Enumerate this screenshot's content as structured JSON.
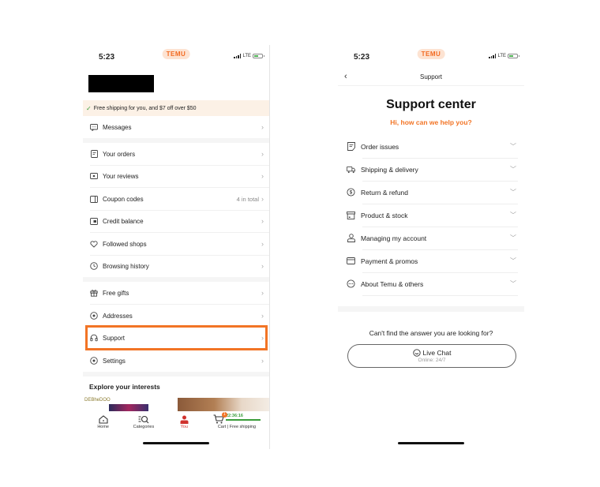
{
  "left_screen": {
    "status": {
      "time": "5:23",
      "brand": "TEMU",
      "network": "LTE"
    },
    "shipping_banner": "Free shipping for you, and $7 off over $50",
    "menu": [
      {
        "label": "Messages",
        "icon": "message-icon"
      },
      {
        "label": "Your orders",
        "icon": "orders-icon"
      },
      {
        "label": "Your reviews",
        "icon": "reviews-icon"
      },
      {
        "label": "Coupon codes",
        "icon": "coupon-icon",
        "meta": "4 in total"
      },
      {
        "label": "Credit balance",
        "icon": "credit-icon"
      },
      {
        "label": "Followed shops",
        "icon": "heart-icon"
      },
      {
        "label": "Browsing history",
        "icon": "clock-icon"
      },
      {
        "label": "Free gifts",
        "icon": "gift-icon"
      },
      {
        "label": "Addresses",
        "icon": "location-icon"
      },
      {
        "label": "Support",
        "icon": "headset-icon",
        "highlighted": true
      },
      {
        "label": "Settings",
        "icon": "settings-icon"
      }
    ],
    "explore_title": "Explore your interests",
    "tile_brand": "DEBheDOO",
    "tabbar": {
      "home": "Home",
      "categories": "Categories",
      "you": "You",
      "cart": "Cart | Free shipping",
      "cart_badge": "1",
      "cart_timer": "22:36:16"
    },
    "highlight_color": "#f27425"
  },
  "right_screen": {
    "status": {
      "time": "5:23",
      "brand": "TEMU",
      "network": "LTE"
    },
    "nav_title": "Support",
    "title": "Support center",
    "subtitle": "Hi, how can we help you?",
    "faq": [
      {
        "label": "Order issues",
        "icon": "order-issues-icon"
      },
      {
        "label": "Shipping & delivery",
        "icon": "truck-icon"
      },
      {
        "label": "Return & refund",
        "icon": "refund-icon"
      },
      {
        "label": "Product & stock",
        "icon": "box-icon"
      },
      {
        "label": "Managing my account",
        "icon": "user-icon"
      },
      {
        "label": "Payment & promos",
        "icon": "card-icon"
      },
      {
        "label": "About Temu & others",
        "icon": "more-icon"
      }
    ],
    "cant_find": "Can't find the answer you are looking for?",
    "live_chat": {
      "label": "Live Chat",
      "status": "Online: 24/7"
    },
    "accent_color": "#f27425"
  }
}
